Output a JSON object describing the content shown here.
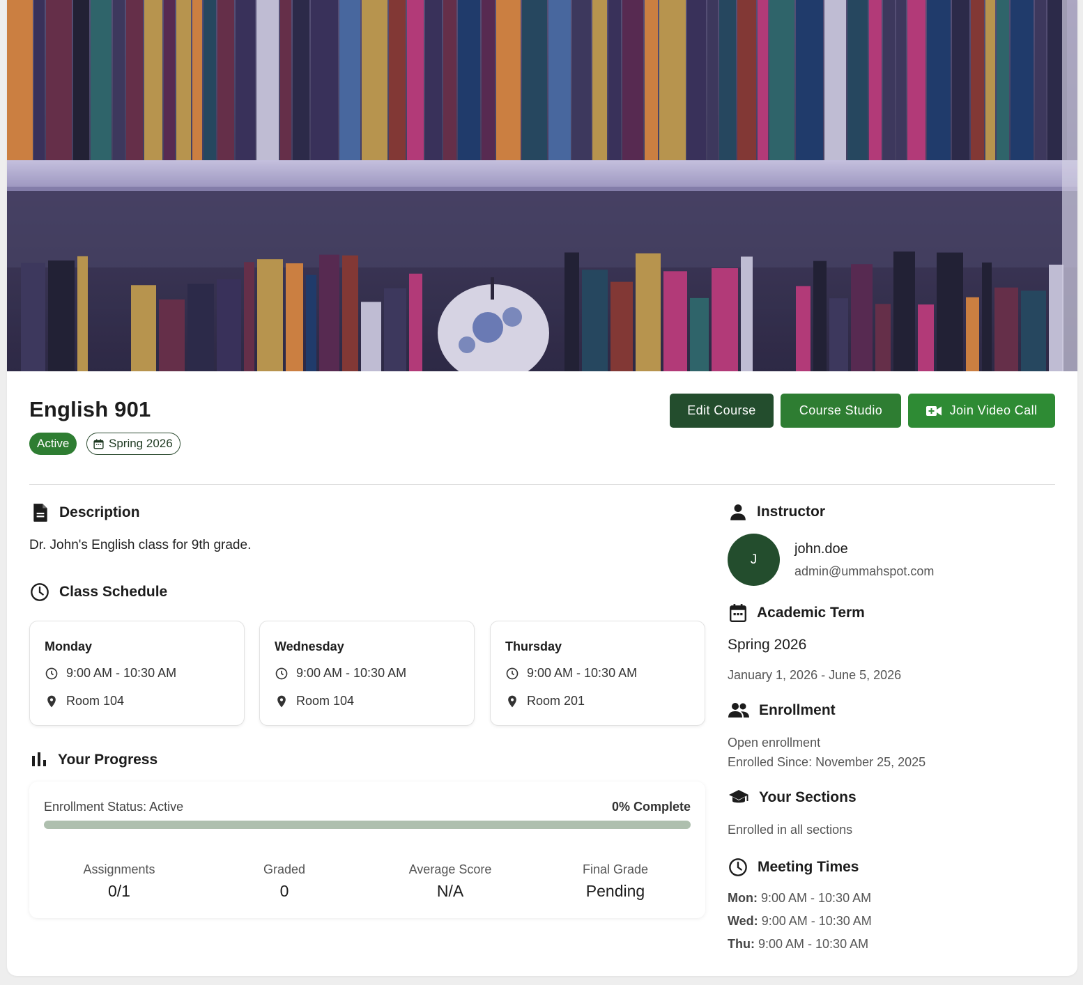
{
  "course": {
    "title": "English 901",
    "status": "Active",
    "term": "Spring 2026"
  },
  "actions": {
    "edit": "Edit Course",
    "studio": "Course Studio",
    "video": "Join Video Call"
  },
  "description": {
    "heading": "Description",
    "text": "Dr. John's English class for 9th grade."
  },
  "schedule": {
    "heading": "Class Schedule",
    "items": [
      {
        "day": "Monday",
        "time": "9:00 AM - 10:30 AM",
        "room": "Room 104"
      },
      {
        "day": "Wednesday",
        "time": "9:00 AM - 10:30 AM",
        "room": "Room 104"
      },
      {
        "day": "Thursday",
        "time": "9:00 AM - 10:30 AM",
        "room": "Room 201"
      }
    ]
  },
  "progress": {
    "heading": "Your Progress",
    "status": "Enrollment Status: Active",
    "complete_label": "0% Complete",
    "percent": 0,
    "stats": [
      {
        "label": "Assignments",
        "value": "0/1"
      },
      {
        "label": "Graded",
        "value": "0"
      },
      {
        "label": "Average Score",
        "value": "N/A"
      },
      {
        "label": "Final Grade",
        "value": "Pending"
      }
    ]
  },
  "instructor": {
    "heading": "Instructor",
    "initial": "J",
    "name": "john.doe",
    "email": "admin@ummahspot.com"
  },
  "term": {
    "heading": "Academic Term",
    "name": "Spring 2026",
    "dates": "January 1, 2026 - June 5, 2026"
  },
  "enrollment": {
    "heading": "Enrollment",
    "type": "Open enrollment",
    "since": "Enrolled Since: November 25, 2025"
  },
  "sections": {
    "heading": "Your Sections",
    "text": "Enrolled in all sections"
  },
  "meetings": {
    "heading": "Meeting Times",
    "items": [
      {
        "day": "Mon:",
        "time": "9:00 AM - 10:30 AM"
      },
      {
        "day": "Wed:",
        "time": "9:00 AM - 10:30 AM"
      },
      {
        "day": "Thu:",
        "time": "9:00 AM - 10:30 AM"
      }
    ]
  },
  "colors": {
    "primary_dark": "#234d2d",
    "primary": "#2e7d32",
    "track": "#aebfae"
  },
  "icons": {
    "banner": "bookshelf-photo",
    "term_chip": "calendar-icon",
    "video": "video-camera-icon",
    "description": "document-icon",
    "schedule": "clock-icon",
    "time": "clock-icon",
    "room": "location-pin-icon",
    "progress": "bar-chart-icon",
    "instructor": "person-icon",
    "term": "calendar-icon",
    "enrollment": "people-icon",
    "sections": "graduation-cap-icon",
    "meetings": "clock-icon"
  }
}
